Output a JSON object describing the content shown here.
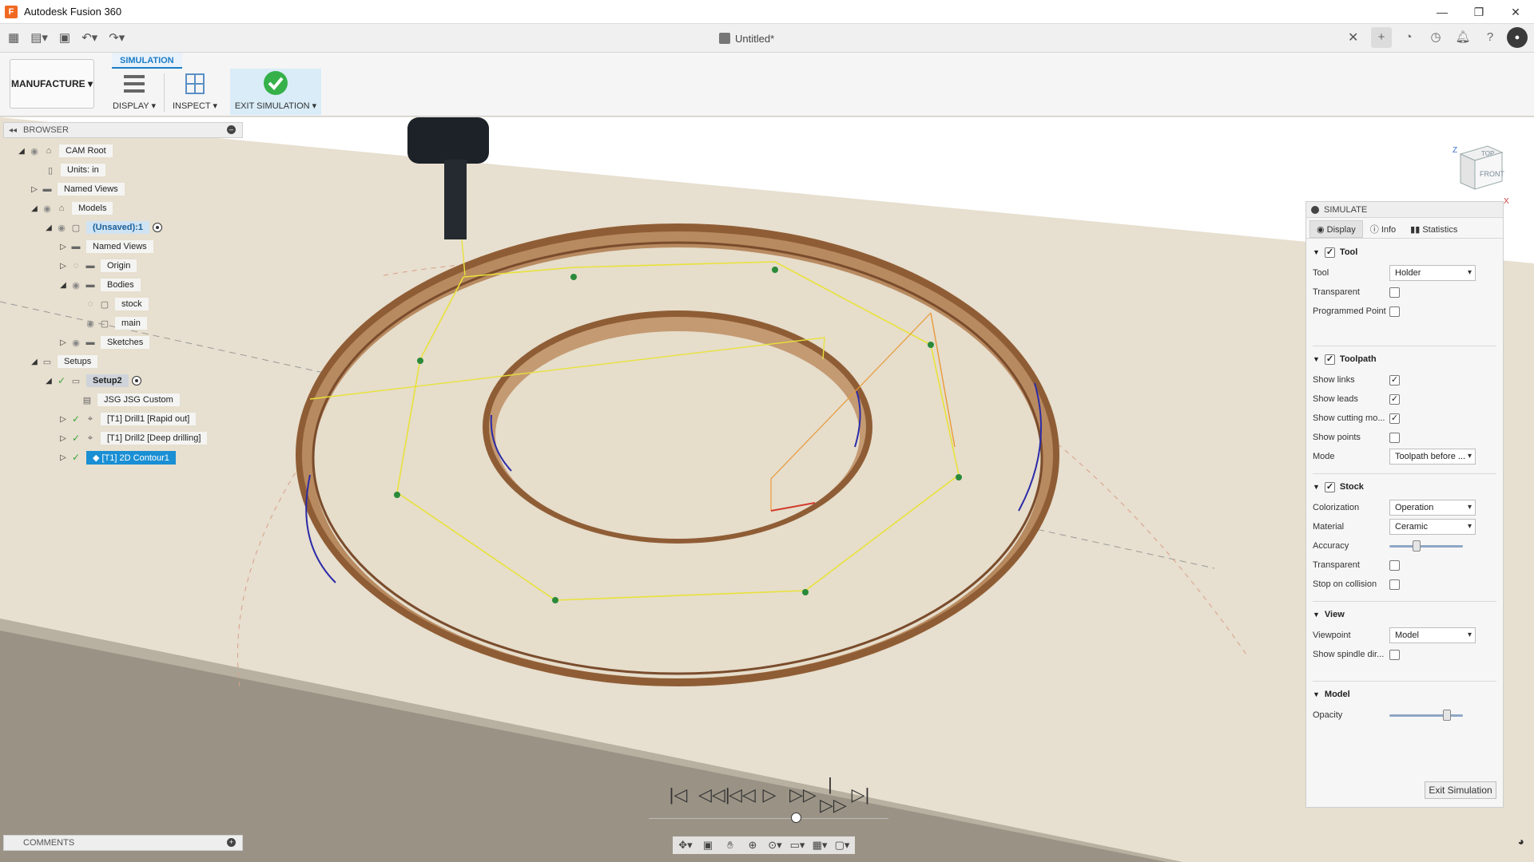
{
  "window": {
    "app_title": "Autodesk Fusion 360",
    "app_icon_letter": "F",
    "controls": [
      "—",
      "❐",
      "✕"
    ]
  },
  "quick_access": {
    "doc_title": "Untitled*",
    "icons": [
      "grid-icon",
      "file-icon",
      "save-icon",
      "undo-icon",
      "redo-icon"
    ],
    "right_icons": [
      "plus-icon",
      "extensions-icon",
      "job-status-icon",
      "notifications-icon",
      "help-icon",
      "user-avatar"
    ]
  },
  "ribbon": {
    "workspace": "MANUFACTURE",
    "active_tab": "SIMULATION",
    "display_label": "DISPLAY",
    "inspect_label": "INSPECT",
    "exit_label": "EXIT SIMULATION"
  },
  "browser": {
    "header": "BROWSER",
    "items": [
      {
        "label": "CAM Root"
      },
      {
        "label": "Units: in"
      },
      {
        "label": "Named Views"
      },
      {
        "label": "Models"
      },
      {
        "label": "(Unsaved):1"
      },
      {
        "label": "Named Views"
      },
      {
        "label": "Origin"
      },
      {
        "label": "Bodies"
      },
      {
        "label": "stock"
      },
      {
        "label": "main"
      },
      {
        "label": "Sketches"
      },
      {
        "label": "Setups"
      },
      {
        "label": "Setup2"
      },
      {
        "label": "JSG JSG Custom"
      },
      {
        "label": "[T1] Drill1 [Rapid out]"
      },
      {
        "label": "[T1] Drill2 [Deep drilling]"
      },
      {
        "label": "[T1] 2D Contour1"
      }
    ]
  },
  "comments": {
    "label": "COMMENTS"
  },
  "view_cube": {
    "top": "TOP",
    "front": "FRONT",
    "axis_z": "Z",
    "axis_x": "X"
  },
  "simulate": {
    "title": "SIMULATE",
    "tabs": [
      "Display",
      "Info",
      "Statistics"
    ],
    "tool": {
      "title": "Tool",
      "tool_label": "Tool",
      "tool_value": "Holder",
      "transparent_label": "Transparent",
      "programmed_point_label": "Programmed Point"
    },
    "toolpath": {
      "title": "Toolpath",
      "show_links_label": "Show links",
      "show_leads_label": "Show leads",
      "show_cutting_label": "Show cutting mo...",
      "show_points_label": "Show points",
      "mode_label": "Mode",
      "mode_value": "Toolpath before ..."
    },
    "stock": {
      "title": "Stock",
      "colorization_label": "Colorization",
      "colorization_value": "Operation",
      "material_label": "Material",
      "material_value": "Ceramic",
      "accuracy_label": "Accuracy",
      "accuracy_level": 0.35,
      "transparent_label": "Transparent",
      "stop_label": "Stop on collision"
    },
    "view": {
      "title": "View",
      "viewpoint_label": "Viewpoint",
      "viewpoint_value": "Model",
      "spindle_label": "Show spindle dir..."
    },
    "model": {
      "title": "Model",
      "opacity_label": "Opacity",
      "opacity_level": 0.82
    },
    "exit_button": "Exit Simulation"
  },
  "playback": {
    "buttons": [
      "|◁",
      "◁◁|",
      "◁◁",
      "▷",
      "▷▷",
      "|▷▷",
      "▷|"
    ],
    "timeline_position": 0.62
  },
  "colors": {
    "accent": "#1a8fd4",
    "stock": "#e6dccb",
    "cut_wall": "#8b5a35",
    "toolpath": "#e8e23a",
    "check_green": "#3aa53a"
  }
}
